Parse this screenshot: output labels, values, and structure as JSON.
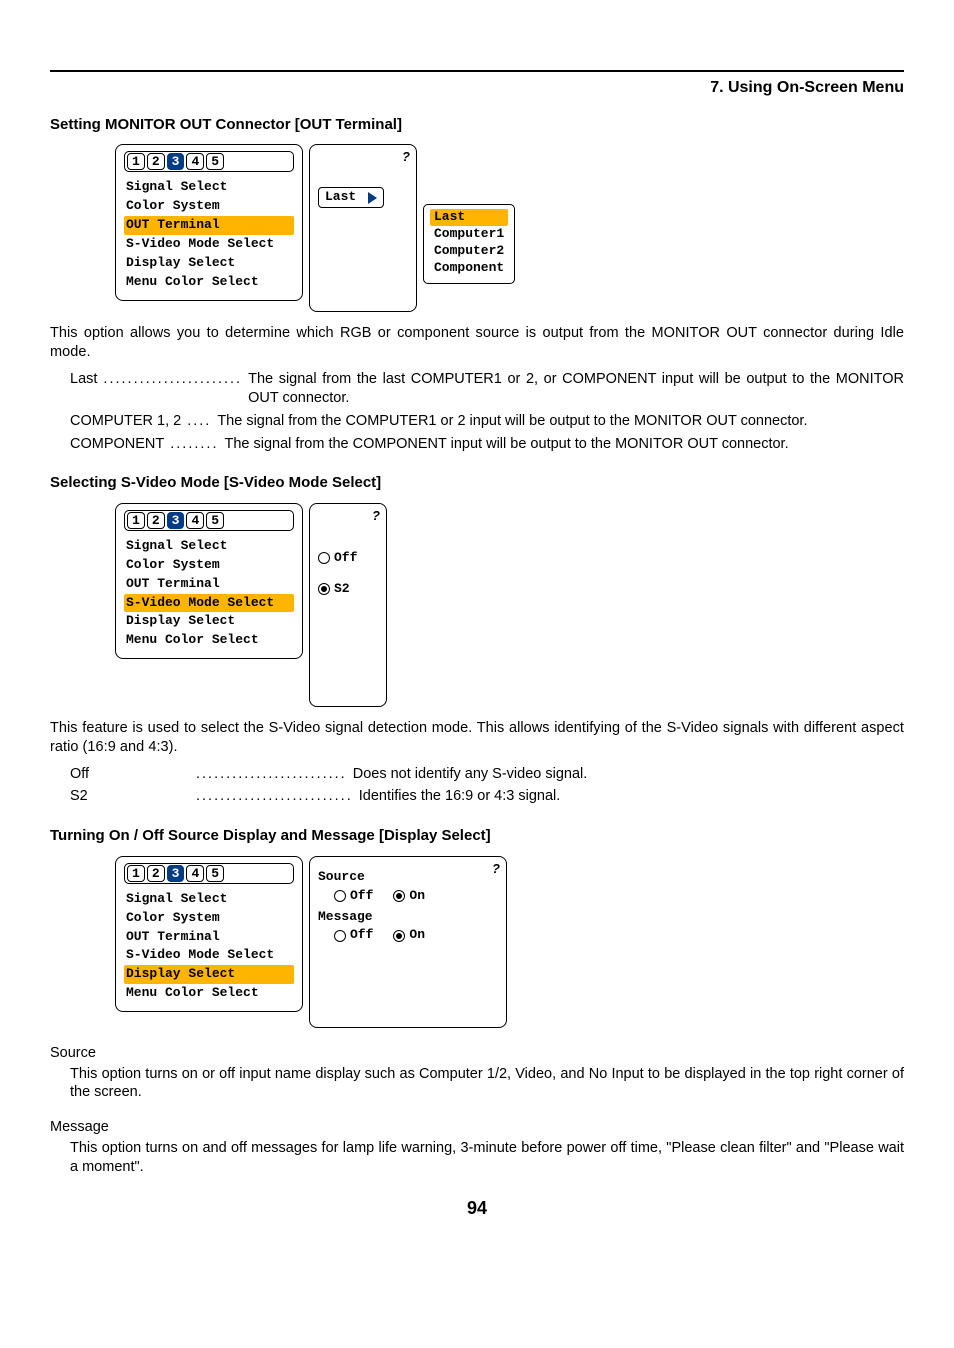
{
  "header": {
    "chapter": "7. Using On-Screen Menu"
  },
  "page_number": "94",
  "s1": {
    "title": "Setting MONITOR OUT Connector [OUT Terminal]",
    "osd": {
      "tabs": [
        "1",
        "2",
        "3",
        "4",
        "5"
      ],
      "active_tab": "3",
      "items": [
        "Signal Select",
        "Color System",
        "OUT Terminal",
        "S-Video Mode Select",
        "Display Select",
        "Menu Color Select"
      ],
      "selected": "OUT Terminal",
      "value": "Last",
      "options": [
        "Last",
        "Computer1",
        "Computer2",
        "Component"
      ],
      "option_selected": "Last"
    },
    "intro": "This option allows you to determine which RGB or component source is output from the MONITOR OUT connector during Idle mode.",
    "defs": [
      {
        "term": "Last",
        "dots": ".......................",
        "val": "The signal from the last COMPUTER1 or 2, or COMPONENT input will be output to the MONITOR OUT connector."
      },
      {
        "term": "COMPUTER 1, 2",
        "dots": "....",
        "val": "The signal from the COMPUTER1 or 2 input will be output to the MONITOR OUT connector."
      },
      {
        "term": "COMPONENT",
        "dots": "........",
        "val": "The signal from the COMPONENT input will be output to the MONITOR OUT connector."
      }
    ]
  },
  "s2": {
    "title": "Selecting S-Video Mode [S-Video Mode Select]",
    "osd": {
      "tabs": [
        "1",
        "2",
        "3",
        "4",
        "5"
      ],
      "active_tab": "3",
      "items": [
        "Signal Select",
        "Color System",
        "OUT Terminal",
        "S-Video Mode Select",
        "Display Select",
        "Menu Color Select"
      ],
      "selected": "S-Video Mode Select",
      "radios": [
        {
          "label": "Off",
          "on": false
        },
        {
          "label": "S2",
          "on": true
        }
      ]
    },
    "intro": "This feature is used to select the S-Video signal detection mode. This allows identifying of the S-Video signals with different aspect ratio (16:9 and 4:3).",
    "defs": [
      {
        "term": "Off",
        "dots": ".........................",
        "val": "Does not identify any S-video signal."
      },
      {
        "term": "S2",
        "dots": "..........................",
        "val": "Identifies the 16:9 or 4:3 signal."
      }
    ]
  },
  "s3": {
    "title": "Turning On / Off Source Display and Message [Display Select]",
    "osd": {
      "tabs": [
        "1",
        "2",
        "3",
        "4",
        "5"
      ],
      "active_tab": "3",
      "items": [
        "Signal Select",
        "Color System",
        "OUT Terminal",
        "S-Video Mode Select",
        "Display Select",
        "Menu Color Select"
      ],
      "selected": "Display Select",
      "groups": [
        {
          "title": "Source",
          "row": [
            {
              "label": "Off",
              "on": false
            },
            {
              "label": "On",
              "on": true
            }
          ]
        },
        {
          "title": "Message",
          "row": [
            {
              "label": "Off",
              "on": false
            },
            {
              "label": "On",
              "on": true
            }
          ]
        }
      ]
    },
    "subs": [
      {
        "title": "Source",
        "desc": "This option turns on or off input name display such as Computer 1/2, Video, and No Input to be displayed in the top right corner of the screen."
      },
      {
        "title": "Message",
        "desc": "This option turns on and off messages for lamp life warning, 3-minute before power off time, \"Please clean filter\" and \"Please wait a moment\"."
      }
    ]
  }
}
